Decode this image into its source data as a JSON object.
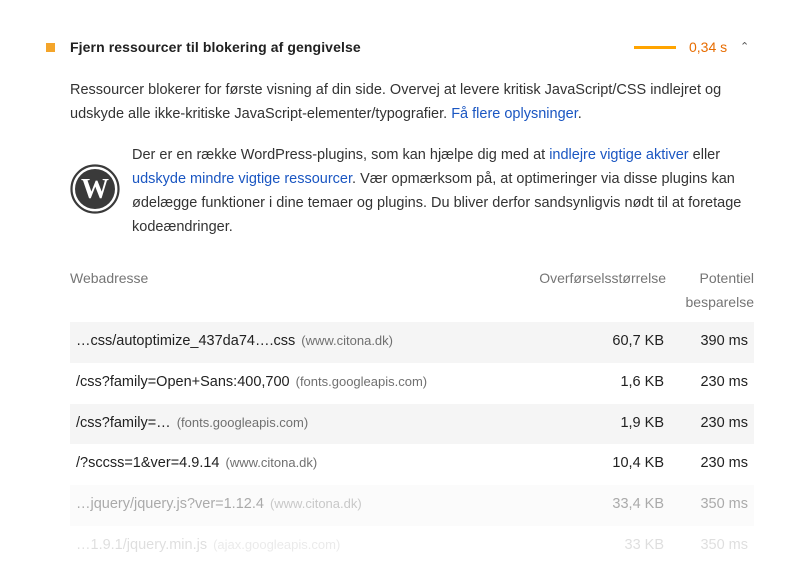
{
  "audit": {
    "title": "Fjern ressourcer til blokering af gengivelse",
    "savings": "0,34 s",
    "status_color": "#f4a52a",
    "savings_color": "#e76c00",
    "chevron_icon": "chevron-up-icon"
  },
  "description": {
    "text": "Ressourcer blokerer for første visning af din side. Overvej at levere kritisk JavaScript/CSS indlejret og udskyde alle ikke-kritiske JavaScript-elementer/typografier. ",
    "link": "Få flere oplysninger",
    "trailing": "."
  },
  "wordpress": {
    "icon": "wordpress-icon",
    "text1": "Der er en række WordPress-plugins, som kan hjælpe dig med at ",
    "link1": "indlejre vigtige aktiver",
    "text2": " eller ",
    "link2": "udskyde mindre vigtige ressourcer",
    "text3": ". Vær opmærksom på, at optimeringer via disse plugins kan ødelægge funktioner i dine temaer og plugins. Du bliver derfor sandsynligvis nødt til at foretage kodeændringer."
  },
  "table": {
    "headers": {
      "url": "Webadresse",
      "size": "Overførselsstørrelse",
      "savings": "Potentiel besparelse"
    },
    "rows": [
      {
        "url": "…css/autoptimize_437da74….css",
        "host": "(www.citona.dk)",
        "size": "60,7 KB",
        "ms": "390 ms"
      },
      {
        "url": "/css?family=Open+Sans:400,700",
        "host": "(fonts.googleapis.com)",
        "size": "1,6 KB",
        "ms": "230 ms"
      },
      {
        "url": "/css?family=…",
        "host": "(fonts.googleapis.com)",
        "size": "1,9 KB",
        "ms": "230 ms"
      },
      {
        "url": "/?sccss=1&ver=4.9.14",
        "host": "(www.citona.dk)",
        "size": "10,4 KB",
        "ms": "230 ms"
      },
      {
        "url": "…jquery/jquery.js?ver=1.12.4",
        "host": "(www.citona.dk)",
        "size": "33,4 KB",
        "ms": "350 ms"
      },
      {
        "url": "…1.9.1/jquery.min.js",
        "host": "(ajax.googleapis.com)",
        "size": "33 KB",
        "ms": "350 ms"
      }
    ]
  }
}
